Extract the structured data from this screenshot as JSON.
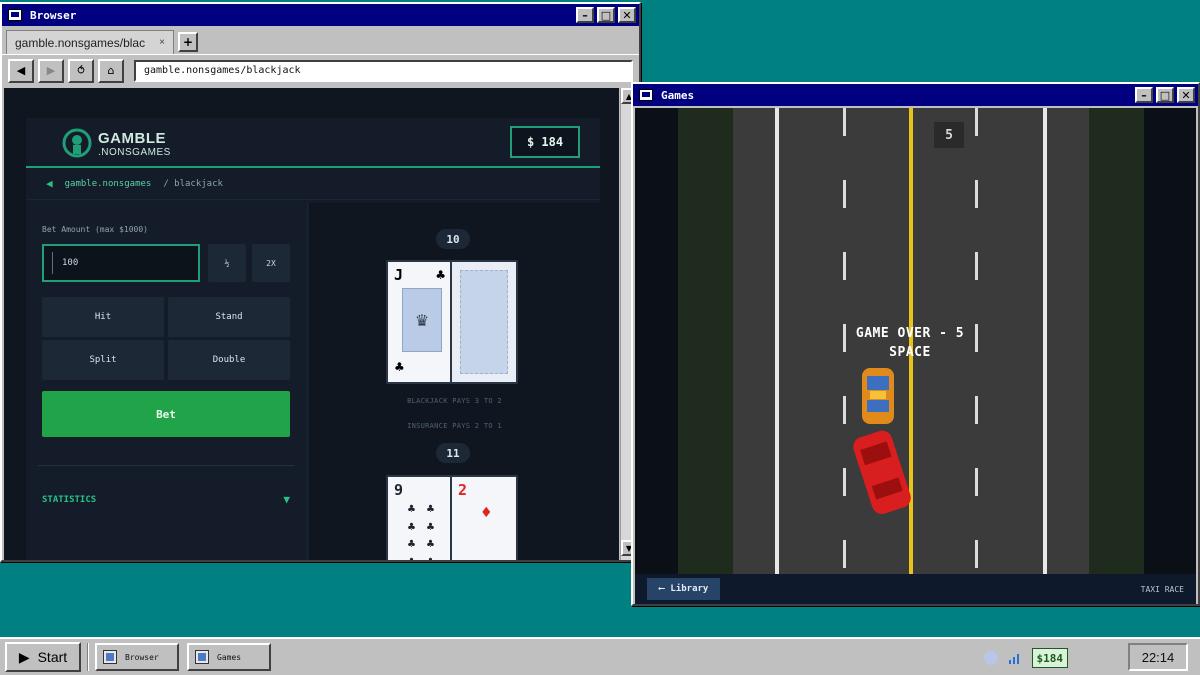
{
  "browser": {
    "title": "Browser",
    "tab_title": "gamble.nonsgames/blac",
    "tab_close": "×",
    "new_tab": "+",
    "url": "gamble.nonsgames/blackjack",
    "nav": {
      "back": "◀",
      "forward": "▶",
      "reload": "⥀",
      "home": "⌂"
    },
    "scroll_up": "▲",
    "scroll_down": "▼"
  },
  "site": {
    "logo_word": "GAMBLE",
    "logo_sub": ".NONSGAMES",
    "balance": "$ 184",
    "breadcrumb": {
      "back": "◀",
      "home": "gamble.nonsgames",
      "current": "/ blackjack"
    },
    "bet_label": "Bet Amount  (max $1000)",
    "bet_value": "100",
    "half": "½",
    "double_x": "2X",
    "actions": {
      "hit": "Hit",
      "stand": "Stand",
      "split": "Split",
      "double": "Double"
    },
    "bet_button": "Bet",
    "statistics": "STATISTICS",
    "statistics_arrow": "▼"
  },
  "table": {
    "dealer_score": "10",
    "player_score": "11",
    "pays_text": "BLACKJACK PAYS 3 TO 2",
    "insurance_text": "INSURANCE PAYS 2 TO 1",
    "dealer_card": {
      "rank": "J",
      "suit": "♣",
      "face": "♛"
    },
    "player_cards": [
      {
        "rank": "9",
        "suit": "♣",
        "color": "#1c2430"
      },
      {
        "rank": "2",
        "suit": "♦",
        "color": "#e02424"
      }
    ]
  },
  "games": {
    "title": "Games",
    "score": "5",
    "game_over": "GAME OVER - 5",
    "prompt": "SPACE",
    "library": "Library",
    "library_arrow": "⟵",
    "game_name": "TAXI RACE"
  },
  "taskbar": {
    "start": "Start",
    "items": [
      "Browser",
      "Games"
    ],
    "balance": "$184",
    "clock": "22:14"
  },
  "window_buttons": {
    "min": "–",
    "max": "□",
    "close": "✕"
  },
  "colors": {
    "accent": "#1f9e77",
    "bet_green": "#21a34a",
    "titlebar": "#000080",
    "desktop": "#008080"
  }
}
